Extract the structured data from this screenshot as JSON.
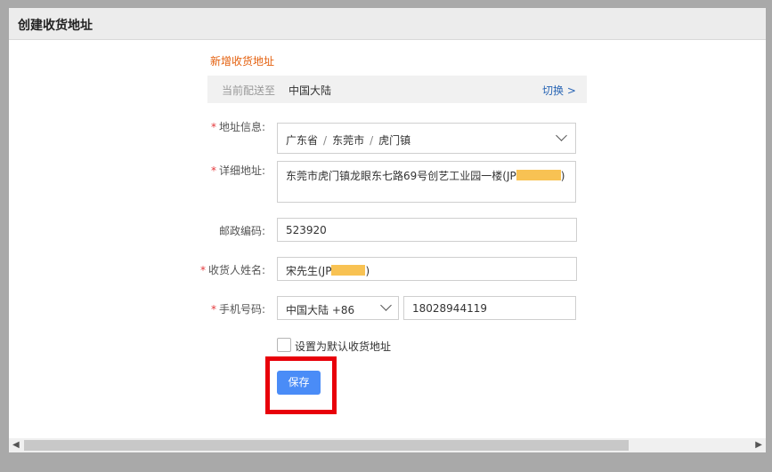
{
  "window": {
    "title": "创建收货地址"
  },
  "form": {
    "section_title": "新增收货地址",
    "ship_to": {
      "label": "当前配送至",
      "value": "中国大陆",
      "switch_label": "切换 >"
    },
    "required_mark": "*",
    "region": {
      "label": "地址信息:",
      "province": "广东省",
      "city": "东莞市",
      "town": "虎门镇",
      "separator": "/"
    },
    "detail": {
      "label": "详细地址:",
      "value": "东莞市虎门镇龙眼东七路69号创艺工业园一楼(JP",
      "value_suffix": ")"
    },
    "postal": {
      "label": "邮政编码:",
      "value": "523920"
    },
    "recipient": {
      "label": "收货人姓名:",
      "value": "宋先生(JP",
      "value_suffix": ")"
    },
    "phone": {
      "label": "手机号码:",
      "prefix": "中国大陆 +86",
      "value": "18028944119"
    },
    "default_checkbox": {
      "label": "设置为默认收货地址",
      "checked": false
    },
    "save_label": "保存"
  },
  "colors": {
    "accent_orange": "#e4600e",
    "link_blue": "#2a66b5",
    "button_blue": "#4a8cf7",
    "highlight_red": "#e8000a",
    "mask_yellow": "#f8c253"
  },
  "scrollbar": {
    "left_arrow": "◀",
    "right_arrow": "▶"
  }
}
